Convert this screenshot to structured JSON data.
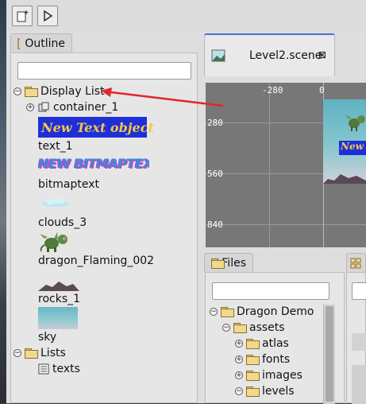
{
  "outline": {
    "tab_label": "Outline",
    "tree": {
      "display_list": "Display List",
      "container": "container_1",
      "text_object": "New Text object",
      "text_label": "text_1",
      "bitmap_art": "NEW BITMAPTEXT",
      "bitmap_label": "bitmaptext",
      "clouds_label": "clouds_3",
      "dragon_label": "dragon_Flaming_002",
      "rocks_label": "rocks_1",
      "sky_label": "sky",
      "lists": "Lists",
      "texts": "texts"
    }
  },
  "editor": {
    "tab_label": "Level2.scene",
    "ruler_x": [
      "-280",
      "0"
    ],
    "ruler_y": [
      "280",
      "560",
      "840"
    ],
    "preview_text": "New"
  },
  "files": {
    "tab_label": "Files",
    "tree": {
      "root": "Dragon Demo",
      "assets": "assets",
      "atlas": "atlas",
      "fonts": "fonts",
      "images": "images",
      "levels": "levels"
    }
  },
  "colors": {
    "accent": "#4a6fd4",
    "annotation_arrow": "#e0262a",
    "text_object_bg": "#1e2fd8",
    "text_object_fg": "#f5c74a"
  }
}
